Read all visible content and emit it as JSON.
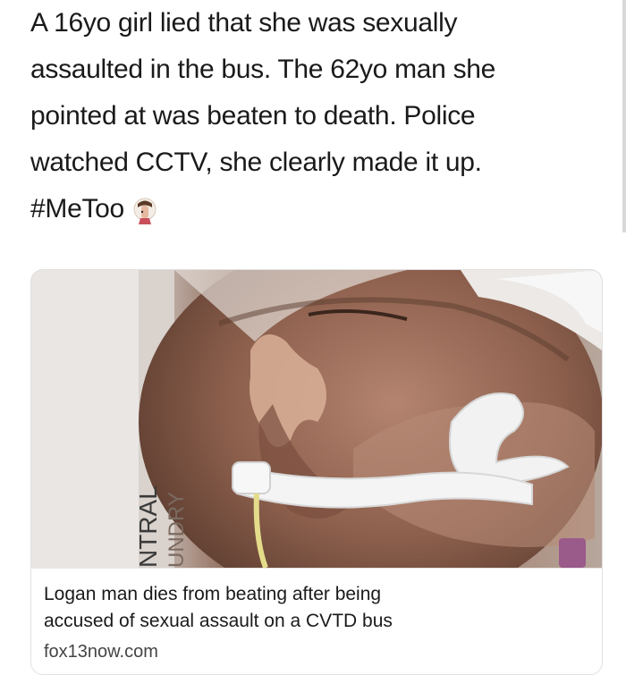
{
  "tweet": {
    "lines": [
      "A 16yo girl lied that she was sexually",
      "assaulted in the bus. The 62yo man she",
      "pointed at was beaten to death. Police",
      "watched CCTV, she clearly made it up."
    ],
    "hashtag": "#MeToo",
    "emoji_icon": "man-facepalming-icon"
  },
  "link_card": {
    "image_icon": "hospital-patient-photo",
    "image_text": [
      "NTRAL",
      "UNDRY"
    ],
    "title_lines": [
      "Logan man dies from beating after being",
      "accused of sexual assault on a CVTD bus"
    ],
    "domain": "fox13now.com"
  },
  "colors": {
    "text": "#1a1a1a",
    "card_border": "#e1e1e1",
    "domain_text": "#444444"
  }
}
